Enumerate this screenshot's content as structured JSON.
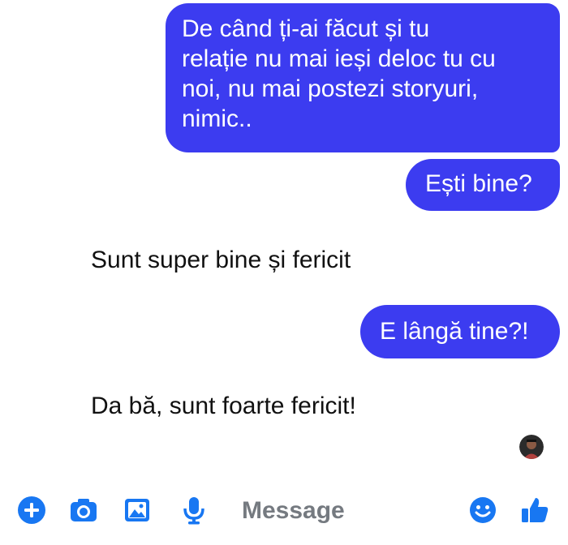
{
  "colors": {
    "outgoing_bubble": "#3c3cf0",
    "accent": "#1877f2"
  },
  "messages": {
    "m1_lines": [
      "De când ți-ai făcut și tu",
      "relație nu mai ieși deloc tu cu",
      "noi, nu mai postezi storyuri,",
      "nimic.."
    ],
    "m2": "Ești bine?",
    "r1": "Sunt super bine și fericit",
    "m3": "E lângă tine?!",
    "r2": "Da bă, sunt foarte fericit!"
  },
  "composer": {
    "placeholder": "Message",
    "icons": [
      "plus-icon",
      "camera-icon",
      "image-icon",
      "microphone-icon",
      "emoji-icon",
      "thumbs-up-icon"
    ]
  }
}
